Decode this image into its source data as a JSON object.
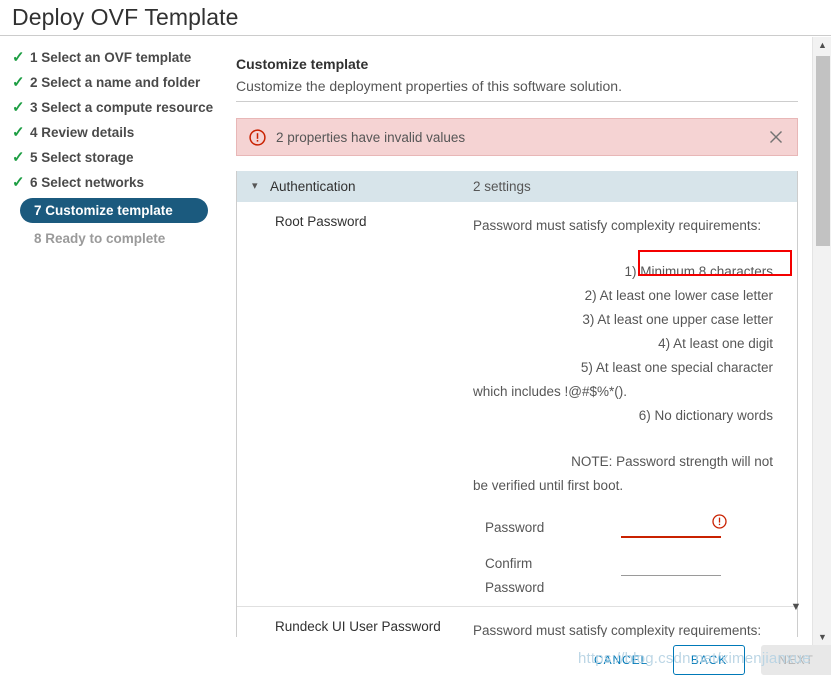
{
  "window": {
    "title": "Deploy OVF Template"
  },
  "steps": [
    {
      "label": "1 Select an OVF template",
      "state": "done",
      "icon": "check-icon"
    },
    {
      "label": "2 Select a name and folder",
      "state": "done",
      "icon": "check-icon"
    },
    {
      "label": "3 Select a compute resource",
      "state": "done",
      "icon": "check-icon"
    },
    {
      "label": "4 Review details",
      "state": "done",
      "icon": "check-icon"
    },
    {
      "label": "5 Select storage",
      "state": "done",
      "icon": "check-icon"
    },
    {
      "label": "6 Select networks",
      "state": "done",
      "icon": "check-icon"
    },
    {
      "label": "7 Customize template",
      "state": "active",
      "icon": ""
    },
    {
      "label": "8 Ready to complete",
      "state": "pending",
      "icon": ""
    }
  ],
  "pane": {
    "heading": "Customize template",
    "subheading": "Customize the deployment properties of this software solution."
  },
  "alert": {
    "icon": "error-circle-icon",
    "message": "2 properties have invalid values",
    "close_icon": "close-icon",
    "background_color": "#f5d3d3",
    "border_color": "#e8b7b7",
    "icon_color": "#c92100"
  },
  "settings": {
    "section": {
      "caret_icon": "chevron-down-icon",
      "name": "Authentication",
      "count": "2 settings"
    },
    "root_password": {
      "label": "Root Password",
      "intro": "Password must satisfy complexity requirements:",
      "rules": [
        "1) Minimum 8 characters",
        "2) At least one lower case letter",
        "3) At least one upper case letter",
        "4) At least one digit",
        "5) At least one special character"
      ],
      "rule5_continuation": "which includes !@#$%*().",
      "rule6": "6) No dictionary words",
      "note_line1": "NOTE: Password strength will not",
      "note_line2": "be verified until first boot.",
      "password_label": "Password",
      "password_value": "",
      "confirm_label_line1": "Confirm",
      "confirm_label_line2": "Password",
      "confirm_value": "",
      "password_error_icon": "error-circle-icon",
      "error_color": "#c92100"
    },
    "rundeck_password": {
      "label": "Rundeck UI User Password",
      "intro": "Password must satisfy complexity requirements:"
    }
  },
  "annotation": {
    "highlight_target": "1) Minimum 8 characters",
    "color": "#f40000"
  },
  "footer": {
    "cancel_label": "CANCEL",
    "back_label": "BACK",
    "next_label": "NEXT",
    "accent_color": "#0079b8"
  },
  "watermark": {
    "text": "https://blog.csdn.net/ximenjianxue"
  },
  "scrollbar": {
    "up_arrow_icon": "caret-up-icon",
    "down_arrow_icon": "caret-down-icon",
    "inner_down_arrow_icon": "caret-down-icon"
  }
}
